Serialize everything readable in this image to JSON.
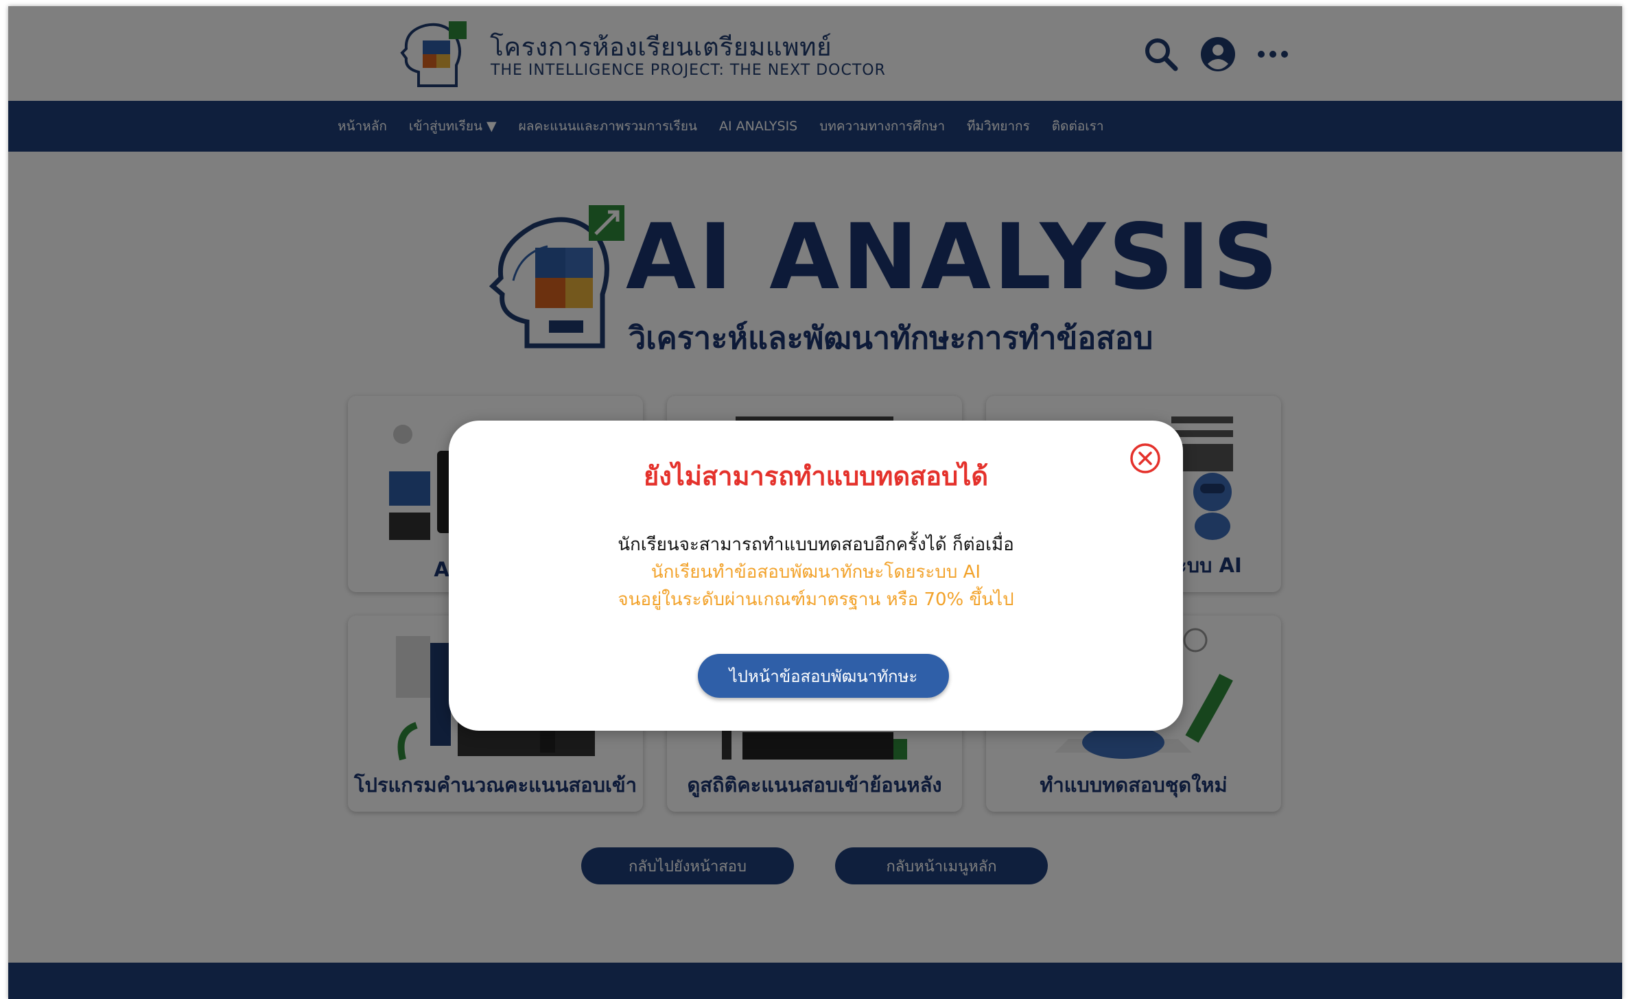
{
  "header": {
    "site_title": "โครงการห้องเรียนเตรียมแพทย์",
    "site_subtitle": "THE INTELLIGENCE PROJECT: THE NEXT DOCTOR",
    "icons": [
      "search-icon",
      "account-icon",
      "more-icon"
    ]
  },
  "nav": {
    "items": [
      {
        "label": "หน้าหลัก"
      },
      {
        "label": "เข้าสู่บทเรียน ▼"
      },
      {
        "label": "ผลคะแนนและภาพรวมการเรียน"
      },
      {
        "label": "AI ANALYSIS"
      },
      {
        "label": "บทความทางการศึกษา"
      },
      {
        "label": "ทีมวิทยากร"
      },
      {
        "label": "ติดต่อเรา"
      }
    ]
  },
  "hero": {
    "title": "AI ANALYSIS",
    "subtitle": "วิเคราะห์และพัฒนาทักษะการทำข้อสอบ"
  },
  "cards": [
    {
      "label": "AI Analysis"
    },
    {
      "label": ""
    },
    {
      "label": "พัฒนาทักษะโดยระบบ AI"
    },
    {
      "label": "โปรแกรมคำนวณคะแนนสอบเข้า"
    },
    {
      "label": "ดูสถิติคะแนนสอบเข้าย้อนหลัง"
    },
    {
      "label": "ทำแบบทดสอบชุดใหม่"
    }
  ],
  "buttons": {
    "back_to_exam": "กลับไปยังหน้าสอบ",
    "back_to_menu": "กลับหน้าเมนูหลัก"
  },
  "modal": {
    "title": "ยังไม่สามารถทำแบบทดสอบได้",
    "line1": "นักเรียนจะสามารถทำแบบทดสอบอีกครั้งได้ ก็ต่อเมื่อ",
    "line2": "นักเรียนทำข้อสอบพัฒนาทักษะโดยระบบ AI",
    "line3": "จนอยู่ในระดับผ่านเกณฑ์มาตรฐาน หรือ 70% ขึ้นไป",
    "button_label": "ไปหน้าข้อสอบพัฒนาทักษะ"
  },
  "colors": {
    "primary_navy": "#1f3f7a",
    "title_navy": "#1b3570",
    "modal_title_red": "#e4312b",
    "modal_highlight_orange": "#f2a22a",
    "modal_button_blue": "#2f5fa8"
  }
}
